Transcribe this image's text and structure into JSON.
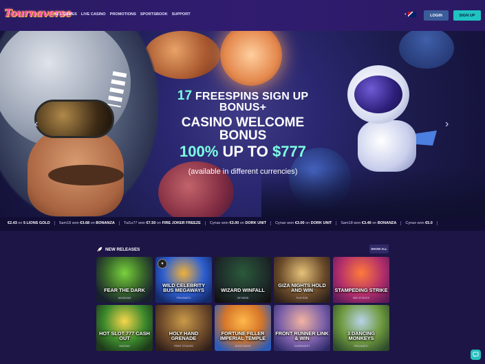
{
  "header": {
    "logo": "Tournaverse",
    "nav": [
      "ALL GAMES",
      "LIVE CASINO",
      "PROMOTIONS",
      "SPORTSBOOK",
      "SUPPORT"
    ],
    "login_label": "LOGIN",
    "signup_label": "SIGN UP"
  },
  "hero": {
    "line1_num": "17",
    "line1_text": " FREESPINS SIGN UP BONUS+",
    "line2": "CASINO WELCOME BONUS",
    "line3_a": "100%",
    "line3_b": " UP TO ",
    "line3_c": "$777",
    "line4": "(available in different currencies)",
    "prev_glyph": "‹",
    "next_glyph": "›"
  },
  "ticker": [
    {
      "pre": "",
      "amount": "€2.43",
      "game": "5 LIONS GOLD"
    },
    {
      "pre": "Sam18 won",
      "amount": "€3.68",
      "game": "BONANZA"
    },
    {
      "pre": "Tui1u77 won",
      "amount": "€7.50",
      "game": "FIRE JOKER FREEZE"
    },
    {
      "pre": "Cynax won",
      "amount": "€3.00",
      "game": "DORK UNIT"
    },
    {
      "pre": "Cynax won",
      "amount": "€3.00",
      "game": "DORK UNIT"
    },
    {
      "pre": "Sam18 won",
      "amount": "€3.40",
      "game": "BONANZA"
    },
    {
      "pre": "Cynax won",
      "amount": "€5.0",
      "game": ""
    }
  ],
  "releases": {
    "title": "NEW RELEASES",
    "show_all": "SHOW ALL",
    "games": [
      {
        "name": "FEAR THE DARK",
        "provider": "NAGNGAM"
      },
      {
        "name": "WILD CELEBRITY BUS MEGAWAYS",
        "provider": "PRAGMATIC"
      },
      {
        "name": "WIZARD WINFALL",
        "provider": "SKYWIND"
      },
      {
        "name": "GIZA NIGHTS HOLD AND WIN",
        "provider": "PLAYSON"
      },
      {
        "name": "STAMPEDING STRIKE",
        "provider": "WIN STUDIOS"
      },
      {
        "name": "HOT SLOT 777 CASH OUT",
        "provider": "WAZDAN"
      },
      {
        "name": "HOLY HAND GRENADE",
        "provider": "PRINT STUDIOS"
      },
      {
        "name": "FORTUNE FILLER IMPERIAL TEMPLE",
        "provider": "ELKSTUDIOS"
      },
      {
        "name": "FRONT RUNNER LINK & WIN",
        "provider": "GAMEBURST"
      },
      {
        "name": "3 DANCING MONKEYS",
        "provider": "PRAGMATIC"
      }
    ]
  },
  "colors": {
    "background": "#1d1546",
    "accent_teal": "#1fc4c2",
    "login_blue": "#3b5c9a",
    "highlight": "#7dffe3"
  }
}
